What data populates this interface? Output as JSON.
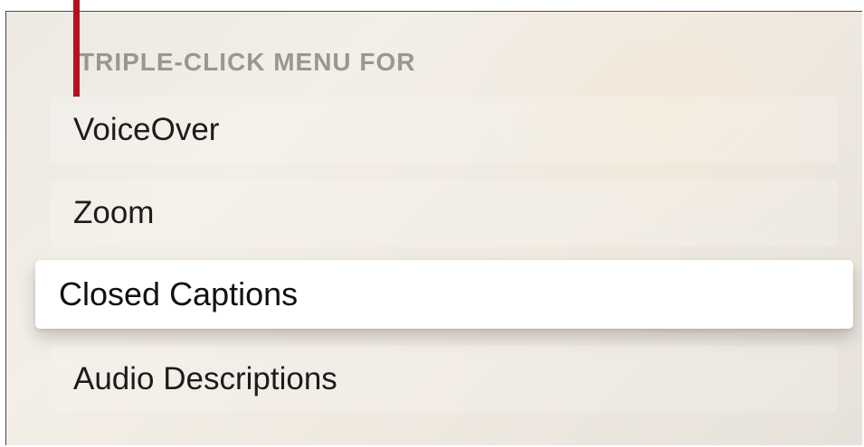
{
  "section": {
    "header": "TRIPLE-CLICK MENU FOR"
  },
  "menu": {
    "items": [
      {
        "label": "VoiceOver",
        "focused": false
      },
      {
        "label": "Zoom",
        "focused": false
      },
      {
        "label": "Closed Captions",
        "focused": true
      },
      {
        "label": "Audio Descriptions",
        "focused": false
      }
    ]
  },
  "colors": {
    "marker": "#b3121e",
    "focused_row": "#ffffff",
    "header_text": "#9a9793"
  }
}
